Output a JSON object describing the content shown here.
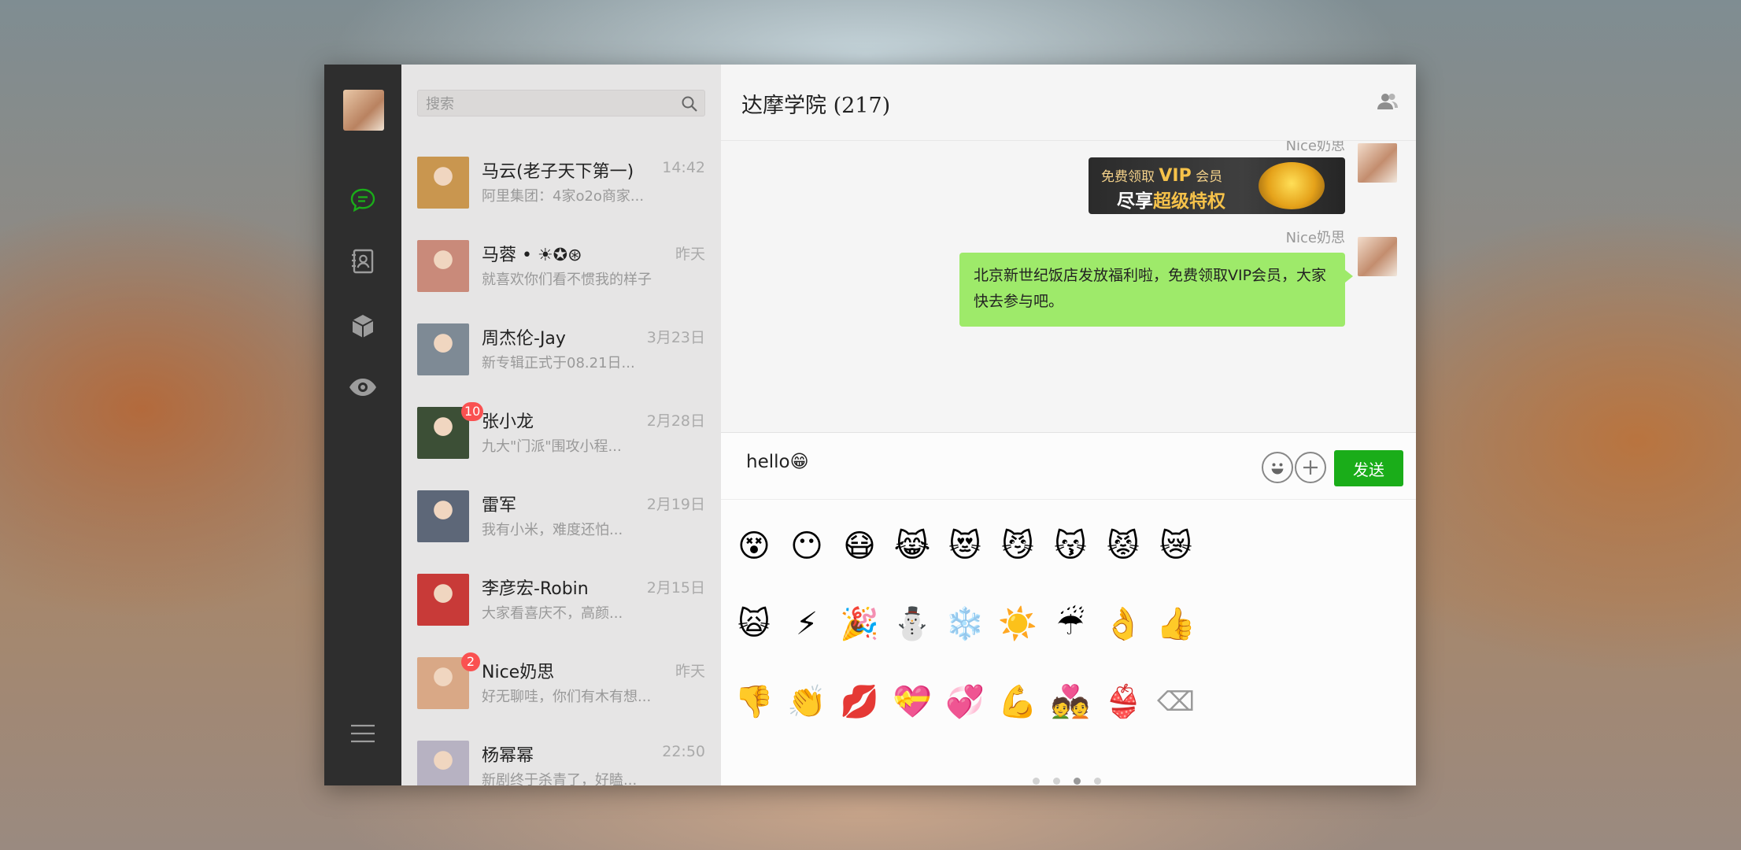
{
  "search": {
    "placeholder": "搜索"
  },
  "nav": {
    "items": [
      "chat-icon",
      "contacts-icon",
      "cube-icon",
      "eye-icon",
      "menu-icon"
    ]
  },
  "conversations": [
    {
      "name": "马云(老子天下第一)",
      "time": "14:42",
      "preview": "阿里集团：4家o2o商家...",
      "badge": "",
      "avatar_color": "#c9964f"
    },
    {
      "name": "马蓉 • ☀✪⊛",
      "time": "昨天",
      "preview": "就喜欢你们看不惯我的样子",
      "badge": "",
      "avatar_color": "#c98a7a"
    },
    {
      "name": "周杰伦-Jay",
      "time": "3月23日",
      "preview": "新专辑正式于08.21日...",
      "badge": "",
      "avatar_color": "#7e8a95"
    },
    {
      "name": "张小龙",
      "time": "2月28日",
      "preview": "九大\"门派\"围攻小程...",
      "badge": "10",
      "avatar_color": "#3c4f36"
    },
    {
      "name": "雷军",
      "time": "2月19日",
      "preview": "我有小米，难度还怕...",
      "badge": "",
      "avatar_color": "#5d6778"
    },
    {
      "name": "李彦宏-Robin",
      "time": "2月15日",
      "preview": "大家看喜庆不，高颜...",
      "badge": "",
      "avatar_color": "#c83a38"
    },
    {
      "name": "Nice奶思",
      "time": "昨天",
      "preview": "好无聊哇，你们有木有想...",
      "badge": "2",
      "avatar_color": "#d9a886"
    },
    {
      "name": "杨幂幂",
      "time": "22:50",
      "preview": "新剧终于杀青了，好瞌...",
      "badge": "",
      "avatar_color": "#b7b2c2"
    }
  ],
  "chat": {
    "title": "达摩学院 (217)",
    "messages": [
      {
        "sender": "Nice奶思",
        "type": "image",
        "banner": {
          "line1_prefix": "免费领取",
          "line1_vip": "VIP",
          "line1_suffix": "会员",
          "line2_prefix": "尽享",
          "line2_highlight": "超级特权"
        }
      },
      {
        "sender": "Nice奶思",
        "type": "text",
        "text": "北京新世纪饭店发放福利啦，免费领取VIP会员，大家快去参与吧。"
      }
    ],
    "input_value": "hello😁",
    "send_label": "发送"
  },
  "emoji_grid": [
    [
      "😵",
      "😶",
      "😷",
      "😹",
      "😻",
      "😼",
      "😽",
      "😾",
      "😿"
    ],
    [
      "🙀",
      "⚡",
      "🎉",
      "⛄",
      "❄️",
      "☀️",
      "☔",
      "👌",
      "👍"
    ],
    [
      "👎",
      "👏",
      "💋",
      "💝",
      "💞",
      "💪",
      "💑",
      "👙",
      "⌫"
    ]
  ],
  "pager": {
    "pages": 4,
    "active": 3
  },
  "tray": {
    "items": [
      "emoji-tab-icon",
      "sticker-pack-1",
      "sticker-pack-2",
      "sticker-pack-3",
      "sticker-pack-4",
      "sticker-pack-5",
      "settings-gear-icon"
    ],
    "sticker_colors": [
      "#6aa0d4",
      "#d9a040",
      "#c35a2e",
      "#e8c23a",
      "#8fbf5a"
    ]
  },
  "colors": {
    "accent_green": "#1aad19",
    "bubble_green": "#9eea6a",
    "badge_red": "#fa5151",
    "nav_bg": "#2e2e2e"
  }
}
